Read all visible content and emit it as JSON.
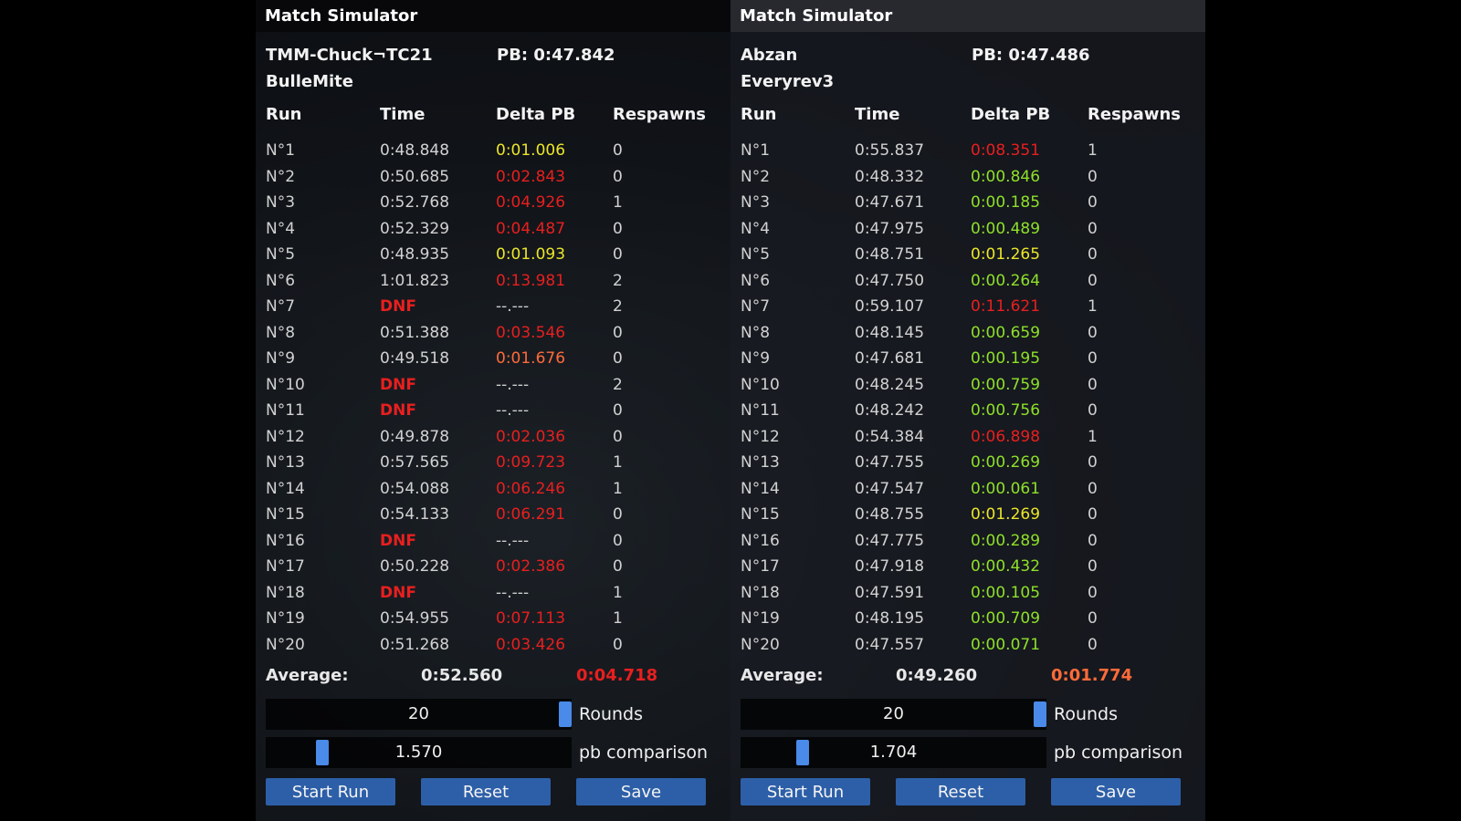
{
  "colors": {
    "good": "#8ee02a",
    "warn": "#ebe52a",
    "bad": "#e81f1f",
    "mid": "#ff6b3a",
    "button": "#2d5fa8",
    "knob": "#4a8ae8"
  },
  "panels": [
    {
      "title": "Match Simulator",
      "player": "TMM-Chuck¬TC21",
      "pb": "PB: 0:47.842",
      "map": "BulleMite",
      "headers": {
        "run": "Run",
        "time": "Time",
        "delta": "Delta PB",
        "respawns": "Respawns"
      },
      "runs": [
        {
          "run": "N°1",
          "time": "0:48.848",
          "delta": "0:01.006",
          "respawns": "0",
          "time_status": "normal",
          "delta_status": "warn"
        },
        {
          "run": "N°2",
          "time": "0:50.685",
          "delta": "0:02.843",
          "respawns": "0",
          "time_status": "normal",
          "delta_status": "bad"
        },
        {
          "run": "N°3",
          "time": "0:52.768",
          "delta": "0:04.926",
          "respawns": "1",
          "time_status": "normal",
          "delta_status": "bad"
        },
        {
          "run": "N°4",
          "time": "0:52.329",
          "delta": "0:04.487",
          "respawns": "0",
          "time_status": "normal",
          "delta_status": "bad"
        },
        {
          "run": "N°5",
          "time": "0:48.935",
          "delta": "0:01.093",
          "respawns": "0",
          "time_status": "normal",
          "delta_status": "warn"
        },
        {
          "run": "N°6",
          "time": "1:01.823",
          "delta": "0:13.981",
          "respawns": "2",
          "time_status": "normal",
          "delta_status": "bad"
        },
        {
          "run": "N°7",
          "time": "DNF",
          "delta": "--.---",
          "respawns": "2",
          "time_status": "dnf",
          "delta_status": "none"
        },
        {
          "run": "N°8",
          "time": "0:51.388",
          "delta": "0:03.546",
          "respawns": "0",
          "time_status": "normal",
          "delta_status": "bad"
        },
        {
          "run": "N°9",
          "time": "0:49.518",
          "delta": "0:01.676",
          "respawns": "0",
          "time_status": "normal",
          "delta_status": "mid"
        },
        {
          "run": "N°10",
          "time": "DNF",
          "delta": "--.---",
          "respawns": "2",
          "time_status": "dnf",
          "delta_status": "none"
        },
        {
          "run": "N°11",
          "time": "DNF",
          "delta": "--.---",
          "respawns": "0",
          "time_status": "dnf",
          "delta_status": "none"
        },
        {
          "run": "N°12",
          "time": "0:49.878",
          "delta": "0:02.036",
          "respawns": "0",
          "time_status": "normal",
          "delta_status": "bad"
        },
        {
          "run": "N°13",
          "time": "0:57.565",
          "delta": "0:09.723",
          "respawns": "1",
          "time_status": "normal",
          "delta_status": "bad"
        },
        {
          "run": "N°14",
          "time": "0:54.088",
          "delta": "0:06.246",
          "respawns": "1",
          "time_status": "normal",
          "delta_status": "bad"
        },
        {
          "run": "N°15",
          "time": "0:54.133",
          "delta": "0:06.291",
          "respawns": "0",
          "time_status": "normal",
          "delta_status": "bad"
        },
        {
          "run": "N°16",
          "time": "DNF",
          "delta": "--.---",
          "respawns": "0",
          "time_status": "dnf",
          "delta_status": "none"
        },
        {
          "run": "N°17",
          "time": "0:50.228",
          "delta": "0:02.386",
          "respawns": "0",
          "time_status": "normal",
          "delta_status": "bad"
        },
        {
          "run": "N°18",
          "time": "DNF",
          "delta": "--.---",
          "respawns": "1",
          "time_status": "dnf",
          "delta_status": "none"
        },
        {
          "run": "N°19",
          "time": "0:54.955",
          "delta": "0:07.113",
          "respawns": "1",
          "time_status": "normal",
          "delta_status": "bad"
        },
        {
          "run": "N°20",
          "time": "0:51.268",
          "delta": "0:03.426",
          "respawns": "0",
          "time_status": "normal",
          "delta_status": "bad"
        }
      ],
      "average": {
        "label": "Average:",
        "time": "0:52.560",
        "delta": "0:04.718",
        "delta_status": "bad"
      },
      "rounds": {
        "value": "20",
        "label": "Rounds",
        "level": 1.0
      },
      "pb_comparison": {
        "value": "1.570",
        "label": "pb comparison",
        "level": 0.17
      },
      "buttons": {
        "start": "Start Run",
        "reset": "Reset",
        "save": "Save"
      }
    },
    {
      "title": "Match Simulator",
      "player": "Abzan",
      "pb": "PB: 0:47.486",
      "map": "Everyrev3",
      "headers": {
        "run": "Run",
        "time": "Time",
        "delta": "Delta PB",
        "respawns": "Respawns"
      },
      "runs": [
        {
          "run": "N°1",
          "time": "0:55.837",
          "delta": "0:08.351",
          "respawns": "1",
          "time_status": "normal",
          "delta_status": "bad"
        },
        {
          "run": "N°2",
          "time": "0:48.332",
          "delta": "0:00.846",
          "respawns": "0",
          "time_status": "normal",
          "delta_status": "good"
        },
        {
          "run": "N°3",
          "time": "0:47.671",
          "delta": "0:00.185",
          "respawns": "0",
          "time_status": "normal",
          "delta_status": "good"
        },
        {
          "run": "N°4",
          "time": "0:47.975",
          "delta": "0:00.489",
          "respawns": "0",
          "time_status": "normal",
          "delta_status": "good"
        },
        {
          "run": "N°5",
          "time": "0:48.751",
          "delta": "0:01.265",
          "respawns": "0",
          "time_status": "normal",
          "delta_status": "warn"
        },
        {
          "run": "N°6",
          "time": "0:47.750",
          "delta": "0:00.264",
          "respawns": "0",
          "time_status": "normal",
          "delta_status": "good"
        },
        {
          "run": "N°7",
          "time": "0:59.107",
          "delta": "0:11.621",
          "respawns": "1",
          "time_status": "normal",
          "delta_status": "bad"
        },
        {
          "run": "N°8",
          "time": "0:48.145",
          "delta": "0:00.659",
          "respawns": "0",
          "time_status": "normal",
          "delta_status": "good"
        },
        {
          "run": "N°9",
          "time": "0:47.681",
          "delta": "0:00.195",
          "respawns": "0",
          "time_status": "normal",
          "delta_status": "good"
        },
        {
          "run": "N°10",
          "time": "0:48.245",
          "delta": "0:00.759",
          "respawns": "0",
          "time_status": "normal",
          "delta_status": "good"
        },
        {
          "run": "N°11",
          "time": "0:48.242",
          "delta": "0:00.756",
          "respawns": "0",
          "time_status": "normal",
          "delta_status": "good"
        },
        {
          "run": "N°12",
          "time": "0:54.384",
          "delta": "0:06.898",
          "respawns": "1",
          "time_status": "normal",
          "delta_status": "bad"
        },
        {
          "run": "N°13",
          "time": "0:47.755",
          "delta": "0:00.269",
          "respawns": "0",
          "time_status": "normal",
          "delta_status": "good"
        },
        {
          "run": "N°14",
          "time": "0:47.547",
          "delta": "0:00.061",
          "respawns": "0",
          "time_status": "normal",
          "delta_status": "good"
        },
        {
          "run": "N°15",
          "time": "0:48.755",
          "delta": "0:01.269",
          "respawns": "0",
          "time_status": "normal",
          "delta_status": "warn"
        },
        {
          "run": "N°16",
          "time": "0:47.775",
          "delta": "0:00.289",
          "respawns": "0",
          "time_status": "normal",
          "delta_status": "good"
        },
        {
          "run": "N°17",
          "time": "0:47.918",
          "delta": "0:00.432",
          "respawns": "0",
          "time_status": "normal",
          "delta_status": "good"
        },
        {
          "run": "N°18",
          "time": "0:47.591",
          "delta": "0:00.105",
          "respawns": "0",
          "time_status": "normal",
          "delta_status": "good"
        },
        {
          "run": "N°19",
          "time": "0:48.195",
          "delta": "0:00.709",
          "respawns": "0",
          "time_status": "normal",
          "delta_status": "good"
        },
        {
          "run": "N°20",
          "time": "0:47.557",
          "delta": "0:00.071",
          "respawns": "0",
          "time_status": "normal",
          "delta_status": "good"
        }
      ],
      "average": {
        "label": "Average:",
        "time": "0:49.260",
        "delta": "0:01.774",
        "delta_status": "mid"
      },
      "rounds": {
        "value": "20",
        "label": "Rounds",
        "level": 1.0
      },
      "pb_comparison": {
        "value": "1.704",
        "label": "pb comparison",
        "level": 0.19
      },
      "buttons": {
        "start": "Start Run",
        "reset": "Reset",
        "save": "Save"
      }
    }
  ]
}
